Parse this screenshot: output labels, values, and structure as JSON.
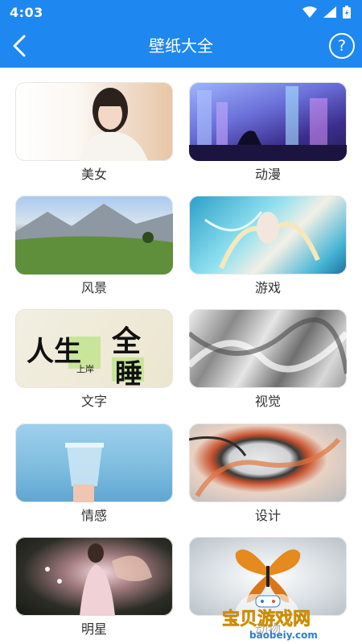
{
  "status_bar": {
    "time": "4:03"
  },
  "app_bar": {
    "title": "壁纸大全",
    "help_symbol": "?"
  },
  "categories": [
    {
      "label": "美女"
    },
    {
      "label": "动漫"
    },
    {
      "label": "风景"
    },
    {
      "label": "游戏"
    },
    {
      "label": "文字"
    },
    {
      "label": "视觉"
    },
    {
      "label": "情感"
    },
    {
      "label": "设计"
    },
    {
      "label": "明星"
    },
    {
      "label": "动物"
    }
  ],
  "wenzi_thumbnail_text": {
    "line1": "人生",
    "line2": "全",
    "line3": "睡",
    "small": "上岸"
  },
  "watermark": {
    "brand": "宝贝游戏网",
    "url": "baobeiy.com"
  },
  "colors": {
    "accent": "#1e88f0"
  }
}
